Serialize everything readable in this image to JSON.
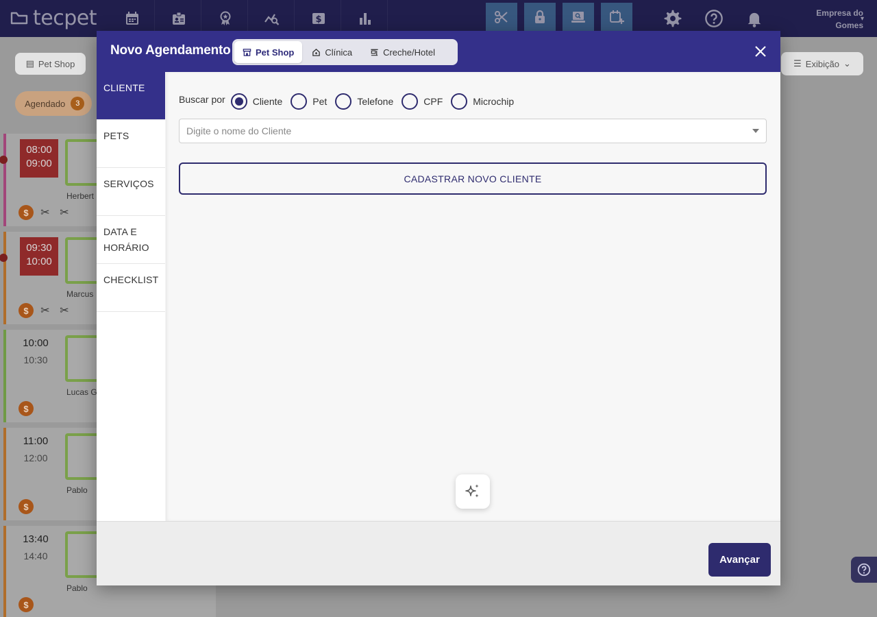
{
  "app": {
    "logo_text": "tecpet"
  },
  "topbar": {
    "company_line1": "Empresa do",
    "company_line2": "Gomes"
  },
  "background": {
    "pet_shop_label": "Pet Shop",
    "exibicao_label": "Exibição",
    "chip_label": "Agendado",
    "chip_count": "3",
    "appointments": [
      {
        "start": "08:00",
        "end": "09:00",
        "name": "Herbert"
      },
      {
        "start": "09:30",
        "end": "10:00",
        "name": "Marcus"
      },
      {
        "start": "10:00",
        "end": "10:30",
        "name": "Lucas Go"
      },
      {
        "start": "11:00",
        "end": "12:00",
        "name": "Pablo"
      },
      {
        "start": "13:40",
        "end": "14:40",
        "name": "Pablo"
      }
    ],
    "coin_symbol": "$"
  },
  "modal": {
    "title": "Novo Agendamento",
    "segments": [
      "Pet Shop",
      "Clínica",
      "Creche/Hotel"
    ],
    "steps": [
      "CLIENTE",
      "PETS",
      "SERVIÇOS",
      "DATA E HORÁRIO",
      "CHECKLIST"
    ],
    "search_by_label": "Buscar por",
    "search_options": [
      "Cliente",
      "Pet",
      "Telefone",
      "CPF",
      "Microchip"
    ],
    "client_placeholder": "Digite o nome do Cliente",
    "new_client_label": "CADASTRAR NOVO CLIENTE",
    "next_label": "Avançar"
  },
  "colors": {
    "primary": "#34308a",
    "primary_dark": "#2e2b6e",
    "quick_action": "#4a74a8"
  }
}
